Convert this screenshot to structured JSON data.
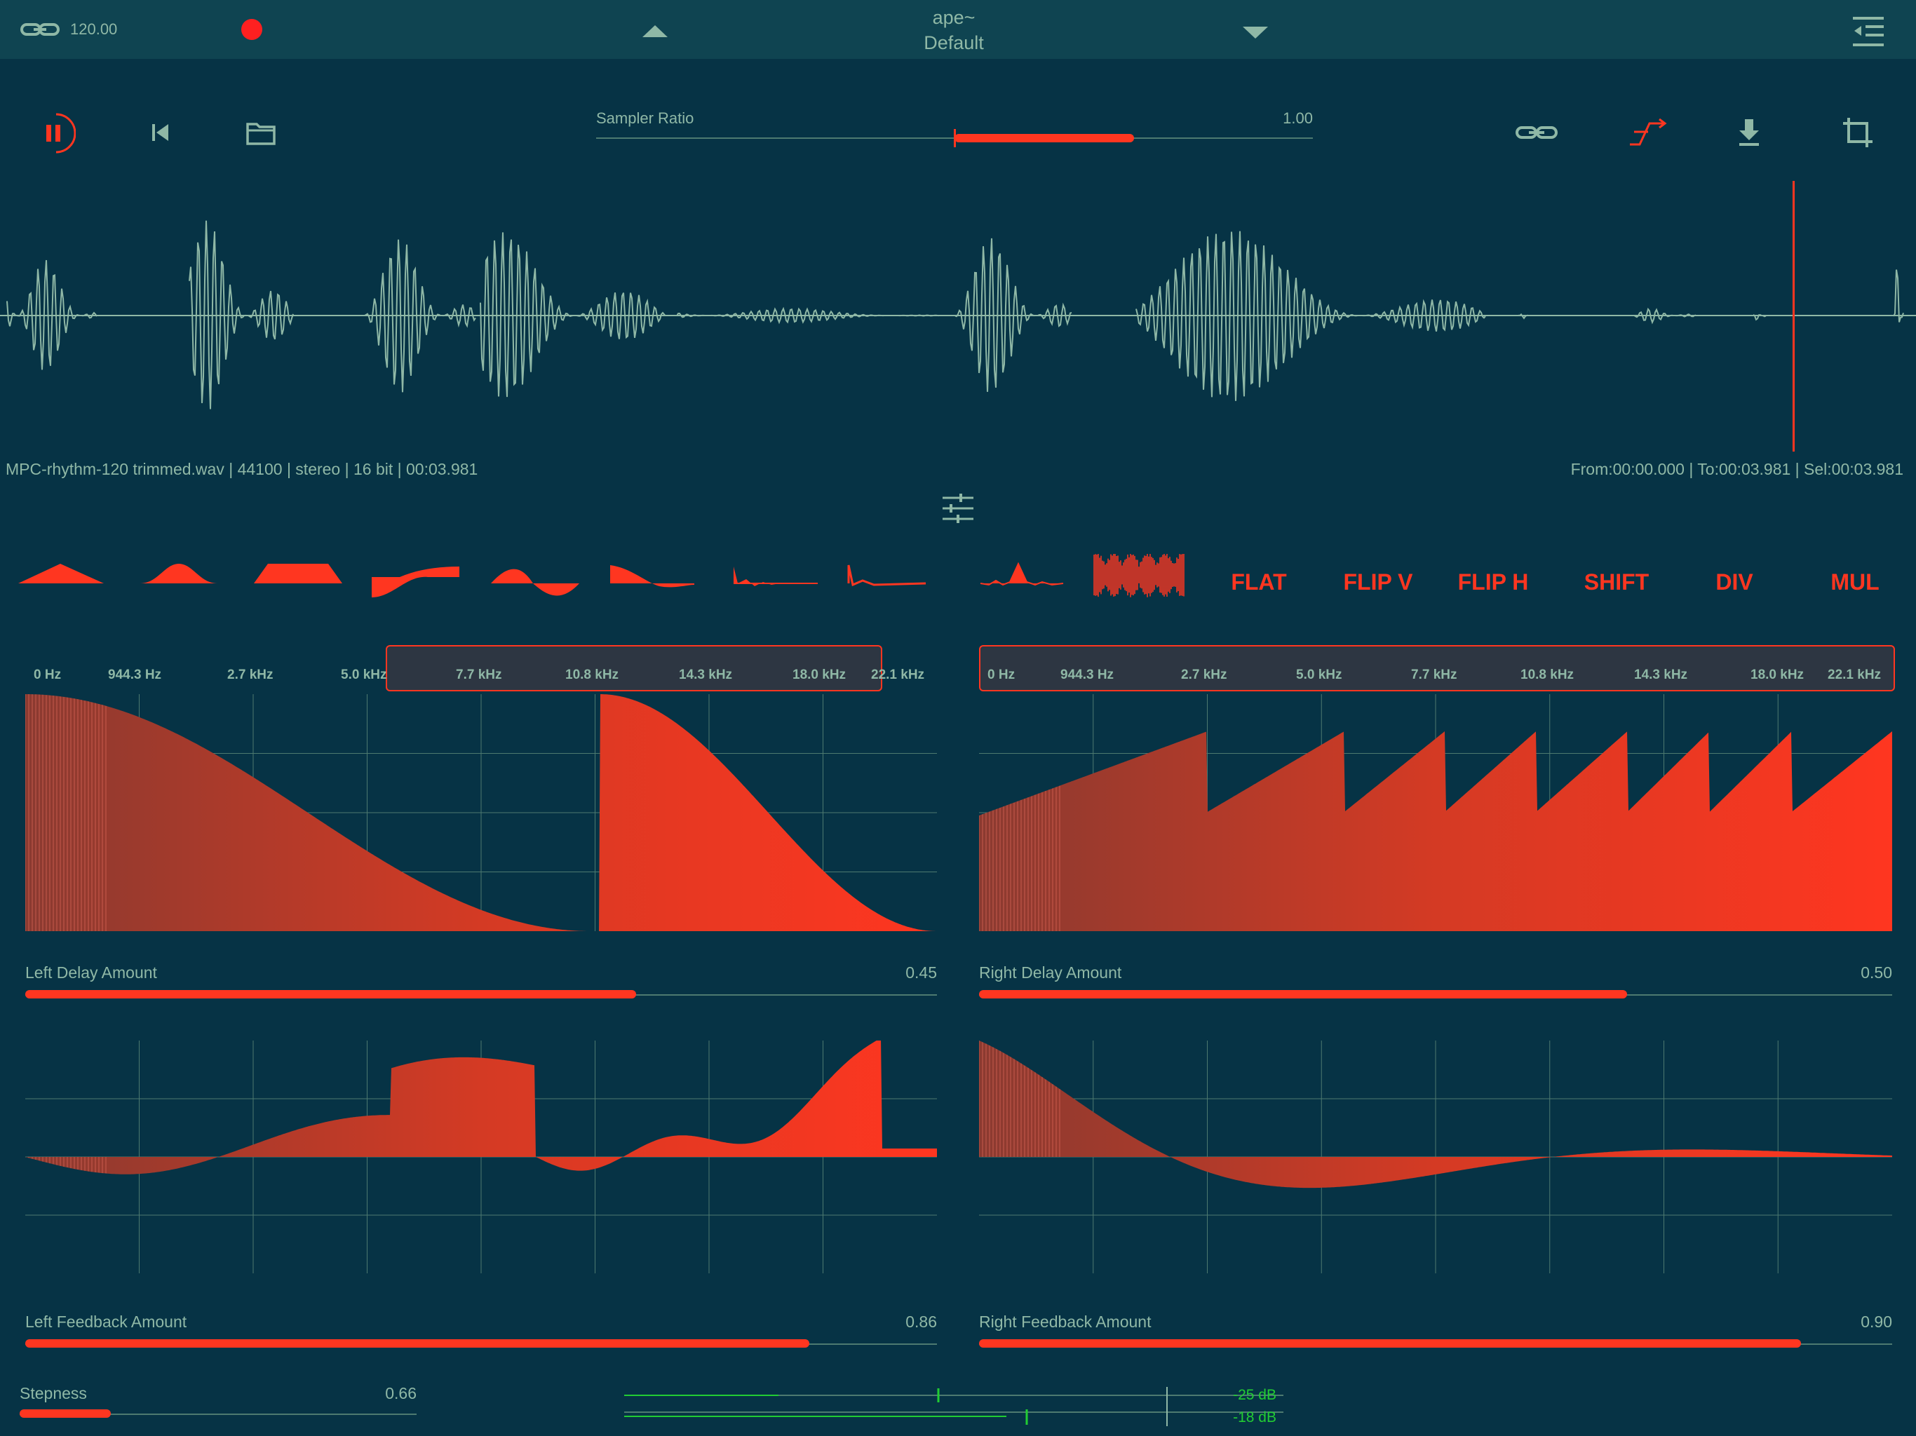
{
  "header": {
    "tempo": "120.00",
    "title": "ape~",
    "preset": "Default"
  },
  "transport": {
    "sampler_ratio_label": "Sampler Ratio",
    "sampler_ratio_value": "1.00",
    "sampler_ratio_level": 0.25
  },
  "file_info": {
    "details": "MPC-rhythm-120 trimmed.wav | 44100 | stereo | 16 bit | 00:03.981",
    "selection": "From:00:00.000 | To:00:03.981 | Sel:00:03.981"
  },
  "shape_buttons": [
    "FLAT",
    "FLIP V",
    "FLIP H",
    "SHIFT",
    "DIV",
    "MUL"
  ],
  "freq_labels": [
    "0 Hz",
    "944.3 Hz",
    "2.7 kHz",
    "5.0 kHz",
    "7.7 kHz",
    "10.8 kHz",
    "14.3 kHz",
    "18.0 kHz",
    "22.1 kHz"
  ],
  "sliders": {
    "left_delay": {
      "label": "Left Delay Amount",
      "value": "0.45",
      "level": 0.67
    },
    "right_delay": {
      "label": "Right Delay Amount",
      "value": "0.50",
      "level": 0.71
    },
    "left_feedback": {
      "label": "Left Feedback Amount",
      "value": "0.86",
      "level": 0.86
    },
    "right_feedback": {
      "label": "Right Feedback Amount",
      "value": "0.90",
      "level": 0.9
    },
    "stepness": {
      "label": "Stepness",
      "value": "0.66",
      "level": 0.23
    }
  },
  "meters": {
    "top_db": "-25 dB",
    "bottom_db": "-18 dB"
  },
  "colors": {
    "background": "#063345",
    "topbar": "#0f4451",
    "accent": "#ff3620",
    "text": "#8fb8a6",
    "meter": "#22cc33"
  }
}
